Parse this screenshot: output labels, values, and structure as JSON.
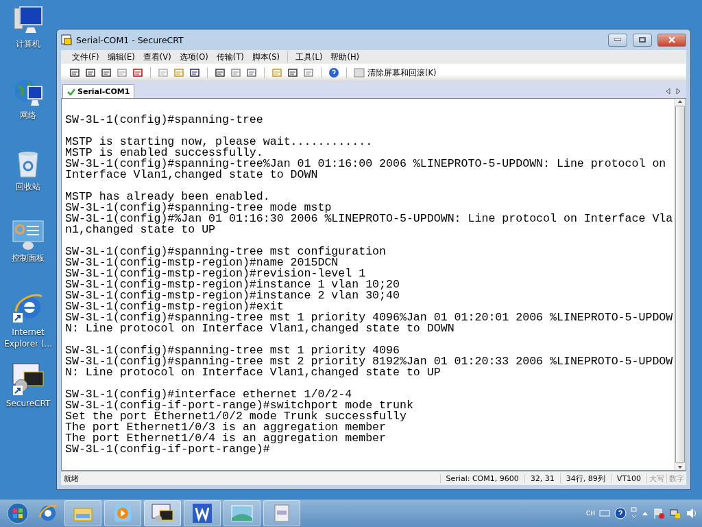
{
  "desktop_icons": [
    {
      "label": "计算机",
      "kind": "computer"
    },
    {
      "label": "网络",
      "kind": "network"
    },
    {
      "label": "回收站",
      "kind": "recycle"
    },
    {
      "label": "控制面板",
      "kind": "control"
    },
    {
      "label": "Internet Explorer (...",
      "kind": "browser"
    },
    {
      "label": "SecureCRT",
      "kind": "terminal"
    }
  ],
  "window": {
    "title": "Serial-COM1 - SecureCRT"
  },
  "menu_groups": [
    [
      "文件(F)",
      "编辑(E)",
      "查看(V)",
      "选项(O)",
      "传输(T)",
      "脚本(S)"
    ],
    [
      "工具(L)",
      "帮助(H)"
    ]
  ],
  "toolbar": {
    "clear_label": "清除屏幕和回滚(K)"
  },
  "tabs": [
    {
      "label": "Serial-COM1",
      "selected": true
    }
  ],
  "terminal_blocks": [
    [
      "SW-3L-1(config)#spanning-tree"
    ],
    [
      "MSTP is starting now, please wait............",
      "MSTP is enabled successfully.",
      "SW-3L-1(config)#spanning-tree%Jan 01 01:16:00 2006 %LINEPROTO-5-UPDOWN: Line protocol on",
      "Interface Vlan1,changed state to DOWN"
    ],
    [
      "MSTP has already been enabled.",
      "SW-3L-1(config)#spanning-tree mode mstp",
      "SW-3L-1(config)#%Jan 01 01:16:30 2006 %LINEPROTO-5-UPDOWN: Line protocol on Interface Vla",
      "n1,changed state to UP"
    ],
    [
      "SW-3L-1(config)#spanning-tree mst configuration",
      "SW-3L-1(config-mstp-region)#name 2015DCN",
      "SW-3L-1(config-mstp-region)#revision-level 1",
      "SW-3L-1(config-mstp-region)#instance 1 vlan 10;20",
      "SW-3L-1(config-mstp-region)#instance 2 vlan 30;40",
      "SW-3L-1(config-mstp-region)#exit",
      "SW-3L-1(config)#spanning-tree mst 1 priority 4096%Jan 01 01:20:01 2006 %LINEPROTO-5-UPDOW",
      "N: Line protocol on Interface Vlan1,changed state to DOWN"
    ],
    [
      "SW-3L-1(config)#spanning-tree mst 1 priority 4096",
      "SW-3L-1(config)#spanning-tree mst 2 priority 8192%Jan 01 01:20:33 2006 %LINEPROTO-5-UPDOW",
      "N: Line protocol on Interface Vlan1,changed state to UP"
    ],
    [
      "SW-3L-1(config)#interface ethernet 1/0/2-4",
      "SW-3L-1(config-if-port-range)#switchport mode trunk",
      "Set the port Ethernet1/0/2 mode Trunk successfully",
      "The port Ethernet1/0/3 is an aggregation member",
      "The port Ethernet1/0/4 is an aggregation member",
      "SW-3L-1(config-if-port-range)#"
    ]
  ],
  "status_bar": {
    "message": "就绪",
    "cells": [
      "Serial: COM1, 9600",
      "32,  31",
      "34行, 89列",
      "VT100"
    ],
    "indicators": [
      {
        "label": "大写",
        "on": false
      },
      {
        "label": "数字",
        "on": false
      }
    ]
  },
  "tray": {
    "language": "CH"
  }
}
